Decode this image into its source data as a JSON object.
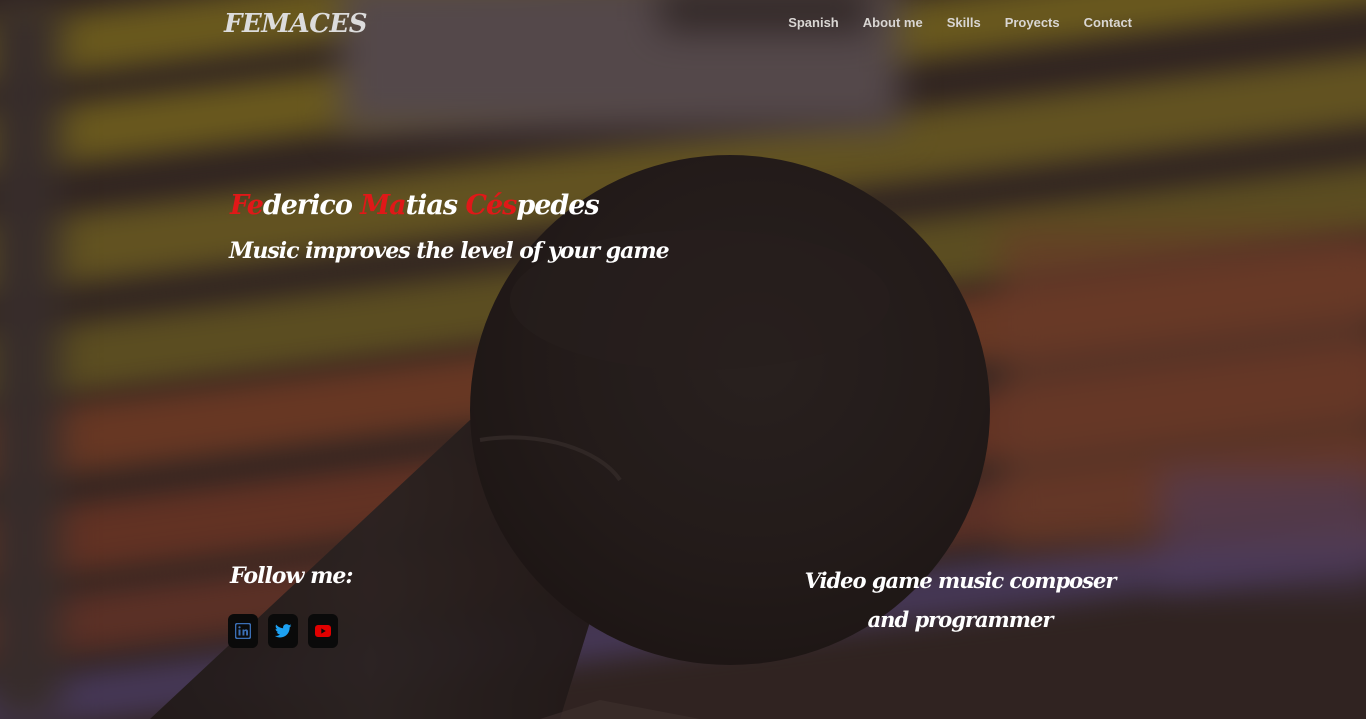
{
  "navbar": {
    "brand": "FEMACES",
    "links": [
      {
        "label": "Spanish"
      },
      {
        "label": "About me"
      },
      {
        "label": "Skills"
      },
      {
        "label": "Proyects"
      },
      {
        "label": "Contact"
      }
    ]
  },
  "hero": {
    "name_parts": [
      {
        "accent": "Fe",
        "rest": "derico "
      },
      {
        "accent": "Ma",
        "rest": "tias "
      },
      {
        "accent": "Cés",
        "rest": "pedes"
      }
    ],
    "tagline": "Music improves the level of your game"
  },
  "follow": {
    "label": "Follow me:",
    "socials": [
      {
        "icon": "linkedin-icon",
        "color": "#3b6fb6"
      },
      {
        "icon": "twitter-icon",
        "color": "#1da1f2"
      },
      {
        "icon": "youtube-icon",
        "color": "#e00000"
      }
    ]
  },
  "role": {
    "text": "Video game music composer and programmer"
  },
  "colors": {
    "accent": "#e01818",
    "text": "#ffffff",
    "nav": "#d9d6d3"
  }
}
